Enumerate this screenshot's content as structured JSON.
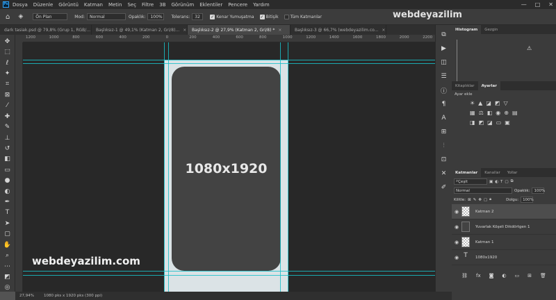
{
  "menu": [
    "Dosya",
    "Düzenle",
    "Görüntü",
    "Katman",
    "Metin",
    "Seç",
    "Filtre",
    "3B",
    "Görünüm",
    "Eklentiler",
    "Pencere",
    "Yardım"
  ],
  "window_controls": [
    "—",
    "□",
    "✕"
  ],
  "options": {
    "preset": "Ön Plan",
    "mode_label": "Mod:",
    "mode_value": "Normal",
    "opacity_label": "Opaklık:",
    "opacity_value": "100%",
    "tolerance_label": "Tolerans:",
    "tolerance_value": "32",
    "antialias_label": "Kenar Yumuşatma",
    "contiguous_label": "Bitişik",
    "all_layers_label": "Tüm Katmanlar"
  },
  "tabs": [
    {
      "label": "dark tasiak.psd @ 79,8% (Grup 1, RGB/..."
    },
    {
      "label": "Başlıksız-1 @ 49,1% (Katman 2, Gri/8)..."
    },
    {
      "label": "Başlıksız-2 @ 27,9% (Katman 2, Gri/8) *"
    },
    {
      "label": "Başlıksız-3 @ 66,7% (webdeyazilim.co..."
    }
  ],
  "ruler_ticks": [
    "1200",
    "1000",
    "800",
    "600",
    "400",
    "200",
    "0",
    "200",
    "400",
    "600",
    "800",
    "1000",
    "1200",
    "1400",
    "1600",
    "1800",
    "2000",
    "2200"
  ],
  "canvas": {
    "phone_text": "1080x1920",
    "watermark": "webdeyazilim.com"
  },
  "status": {
    "zoom": "27,94%",
    "doc_size": "1080 pks x 1920 pks (300 ppi)"
  },
  "histogram_tabs": [
    "Histogram",
    "Gezgin"
  ],
  "adjust_tabs": [
    "Kitaplıklar",
    "Ayarlar"
  ],
  "adjust_label": "Ayar ekle",
  "layers_tabs": [
    "Katmanlar",
    "Kanallar",
    "Yollar"
  ],
  "layers_controls": {
    "kind": "Çeşit",
    "blend": "Normal",
    "opacity_label": "Opaklık:",
    "opacity_value": "100%",
    "lock_label": "Kilitle:",
    "fill_label": "Dolgu:",
    "fill_value": "100%"
  },
  "layers": [
    {
      "name": "Katman 2",
      "selected": true,
      "type": "pixel"
    },
    {
      "name": "Yuvarlak Köşeli Dikdörtgen 1",
      "selected": false,
      "type": "shape"
    },
    {
      "name": "Katman 1",
      "selected": false,
      "type": "pixel"
    },
    {
      "name": "1080x1920",
      "selected": false,
      "type": "text"
    }
  ],
  "top_watermark": "webdeyazilim",
  "colors": {
    "guide": "#19c0c8",
    "canvas_bg": "#282828",
    "document": "#dbe3e6",
    "phone": "#434343"
  }
}
